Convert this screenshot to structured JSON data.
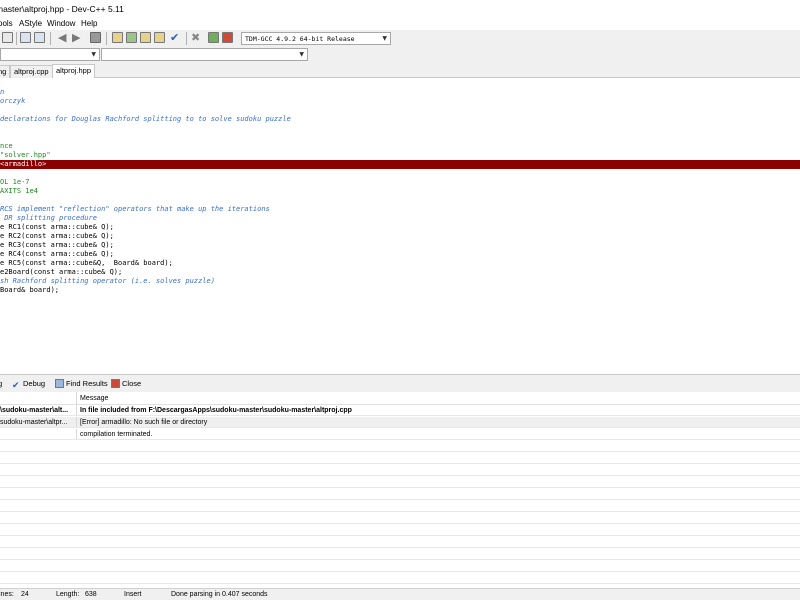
{
  "window": {
    "title": "master\\altproj.hpp - Dev-C++ 5.11"
  },
  "menu": {
    "items": [
      "ools",
      "AStyle",
      "Window",
      "Help"
    ]
  },
  "toolbar": {
    "compiler": "TDM-GCC 4.9.2 64-bit Release",
    "compiler_arrow": "▼",
    "combo2_arrow": "▼",
    "combo3_arrow": "▼"
  },
  "tabs": [
    "ng",
    "altproj.cpp",
    "altproj.hpp"
  ],
  "editor": {
    "lines": [
      "n",
      "orczyk",
      "",
      "declarations for Douglas Rachford splitting to to solve sudoku puzzle",
      "",
      "",
      "nce",
      "\"solver.hpp\"",
      "<armadillo>",
      "",
      "OL 1e-7",
      "AXITS 1e4",
      "",
      "RCS implement \"reflection\" operators that make up the iterations",
      " DR splitting procedure",
      "e RC1(const arma::cube& Q);",
      "e RC2(const arma::cube& Q);",
      "e RC3(const arma::cube& Q);",
      "e RC4(const arma::cube& Q);",
      "e RC5(const arma::cube&Q,  Board& board);",
      "e2Board(const arma::cube& Q);",
      "sh Rachford splitting operator (i.e. solves puzzle)",
      "Board& board);"
    ]
  },
  "bottom_tabs": {
    "log": "g",
    "debug": "Debug",
    "find": "Find Results",
    "close": "Close"
  },
  "messages": {
    "header": "Message",
    "rows": [
      {
        "file": "\\sudoku-master\\alt...",
        "message": "In file included from F:\\DescargasApps\\sudoku-master\\sudoku-master\\altproj.cpp"
      },
      {
        "file": "sudoku-master\\altpr...",
        "message": "[Error] armadillo: No such file or directory"
      },
      {
        "file": "",
        "message": "compilation terminated."
      }
    ]
  },
  "status": {
    "lines_label": "ines:",
    "lines_value": "24",
    "length_label": "Length:",
    "length_value": "638",
    "mode": "Insert",
    "parse": "Done parsing in 0.407 seconds"
  }
}
